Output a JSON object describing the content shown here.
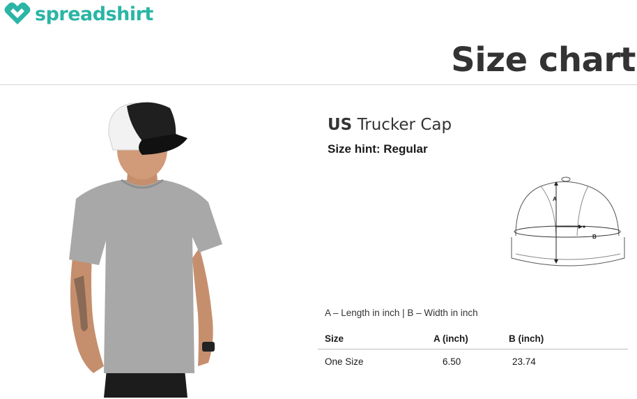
{
  "brand": {
    "logo_icon": "heart-diamond-icon",
    "name": "spreadshirt",
    "color": "#2ab5a5"
  },
  "page_title": "Size chart",
  "product": {
    "country": "US",
    "name": "Trucker Cap",
    "size_hint": "Size hint: Regular"
  },
  "diagram": {
    "icon": "cap-measurement-diagram",
    "label_a": "A",
    "label_b": "B"
  },
  "legend": "A – Length in inch | B – Width in inch",
  "table": {
    "headers": [
      "Size",
      "A (inch)",
      "B (inch)"
    ],
    "rows": [
      [
        "One Size",
        "6.50",
        "23.74"
      ]
    ]
  }
}
